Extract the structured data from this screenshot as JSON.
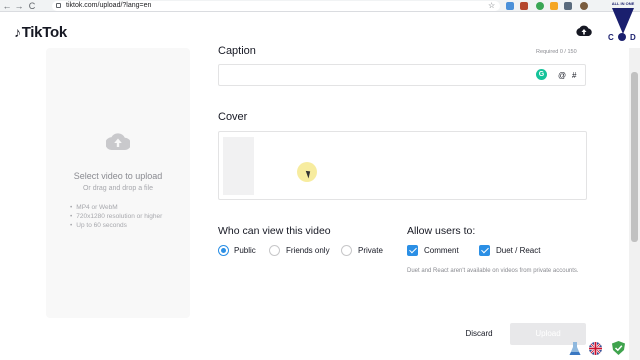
{
  "browser": {
    "back": "←",
    "forward": "→",
    "reload": "C",
    "url": "tiktok.com/upload/?lang=en",
    "star": "☆",
    "corner_logo_caption": "ALL IN ONE",
    "corner_logo_c": "C",
    "corner_logo_d": "D"
  },
  "app": {
    "logo_glyph": "♪",
    "logo_text": "TikTok",
    "upload_icon": "cloud-upload-icon"
  },
  "upload_card": {
    "title": "Select video to upload",
    "subtitle": "Or drag and drop a file",
    "requirements": [
      "MP4 or WebM",
      "720x1280 resolution or higher",
      "Up to 60 seconds"
    ]
  },
  "caption": {
    "label": "Caption",
    "hint": "Required   0 / 150",
    "value": "",
    "grammarly": "G",
    "mention": "@",
    "hashtag": "#"
  },
  "cover": {
    "label": "Cover"
  },
  "privacy": {
    "title": "Who can view this video",
    "options": [
      "Public",
      "Friends only",
      "Private"
    ],
    "selected": "Public"
  },
  "allow": {
    "title": "Allow users to:",
    "options": [
      {
        "label": "Comment",
        "checked": true
      },
      {
        "label": "Duet / React",
        "checked": true
      }
    ],
    "note": "Duet and React aren't available on videos from private accounts."
  },
  "actions": {
    "discard": "Discard",
    "post": "Upload"
  },
  "colors": {
    "accent": "#2b8fe5",
    "disabled_button": "#e8e8ea",
    "grammarly": "#15c39a"
  }
}
